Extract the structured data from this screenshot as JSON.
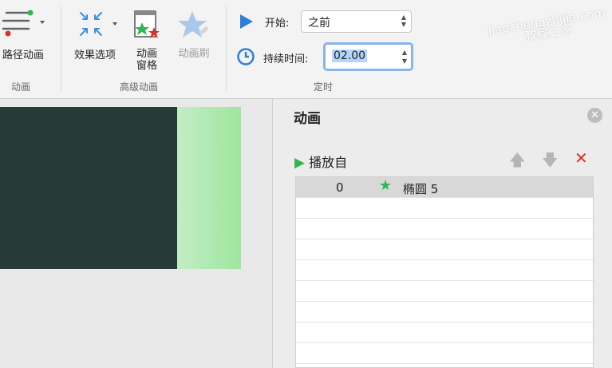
{
  "ribbon": {
    "path_animation": "路径动画",
    "effect_options": "效果选项",
    "animation_pane": "动画\n窗格",
    "animation_painter": "动画刷",
    "group_animation": "动画",
    "group_advanced": "高级动画",
    "group_timing": "定时",
    "start_label": "开始:",
    "start_value": "之前",
    "duration_label": "持续时间:",
    "duration_value": "02.00"
  },
  "watermark": "jiaochengzhijia.com\n教程之家",
  "pane": {
    "title": "动画",
    "play_from": "播放自",
    "items": [
      {
        "order": "0",
        "name": "椭圆 5"
      }
    ]
  },
  "colors": {
    "slide_dark": "#263a36",
    "slide_green": "#a8e8a8",
    "play_green": "#2db84d",
    "delete_red": "#d9322e",
    "focus_blue": "#86b4ee"
  }
}
